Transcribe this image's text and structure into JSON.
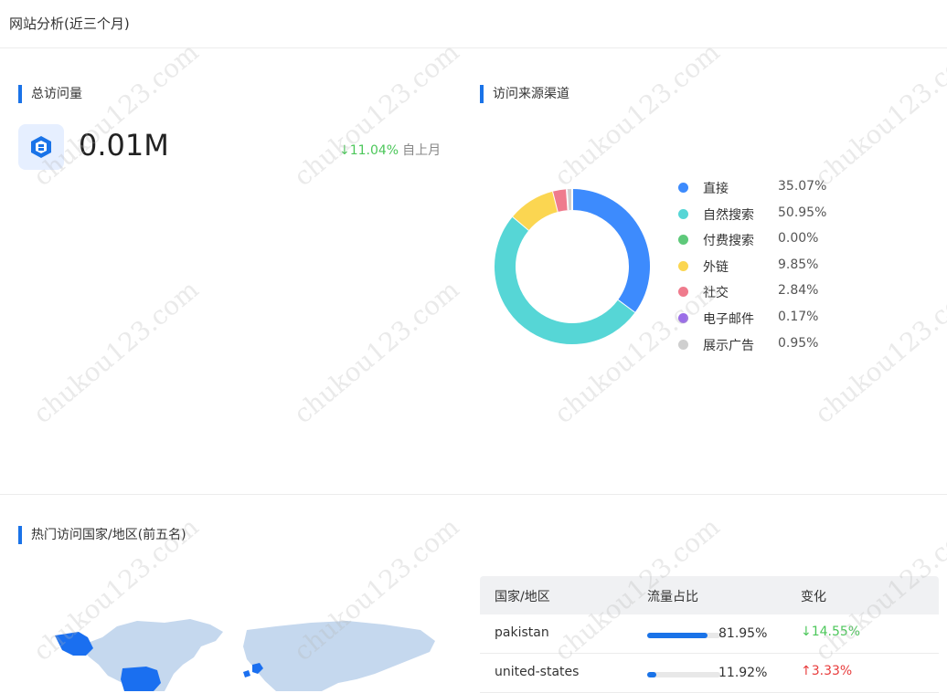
{
  "header": {
    "title": "网站分析(近三个月)"
  },
  "visits": {
    "title": "总访问量",
    "value": "0.01M",
    "change": "↓11.04%",
    "change_label": "自上月"
  },
  "channels": {
    "title": "访问来源渠道",
    "items": [
      {
        "label": "直接",
        "value": "35.07%",
        "color": "#3d8bfd"
      },
      {
        "label": "自然搜索",
        "value": "50.95%",
        "color": "#56d6d6"
      },
      {
        "label": "付费搜索",
        "value": "0.00%",
        "color": "#5ec97a"
      },
      {
        "label": "外链",
        "value": "9.85%",
        "color": "#fbd651"
      },
      {
        "label": "社交",
        "value": "2.84%",
        "color": "#ef7b8d"
      },
      {
        "label": "电子邮件",
        "value": "0.17%",
        "color": "#9b6ee8"
      },
      {
        "label": "展示广告",
        "value": "0.95%",
        "color": "#cfcfcf"
      }
    ]
  },
  "chart_data": {
    "type": "pie",
    "categories": [
      "直接",
      "自然搜索",
      "付费搜索",
      "外链",
      "社交",
      "电子邮件",
      "展示广告"
    ],
    "values": [
      35.07,
      50.95,
      0.0,
      9.85,
      2.84,
      0.17,
      0.95
    ]
  },
  "countries": {
    "title": "热门访问国家/地区(前五名)",
    "columns": [
      "国家/地区",
      "流量占比",
      "变化"
    ],
    "rows": [
      {
        "country": "pakistan",
        "share": "81.95%",
        "share_value": 81.95,
        "change": "↓14.55%",
        "direction": "down"
      },
      {
        "country": "united-states",
        "share": "11.92%",
        "share_value": 11.92,
        "change": "↑3.33%",
        "direction": "up"
      }
    ]
  },
  "watermark": "chukou123.com"
}
